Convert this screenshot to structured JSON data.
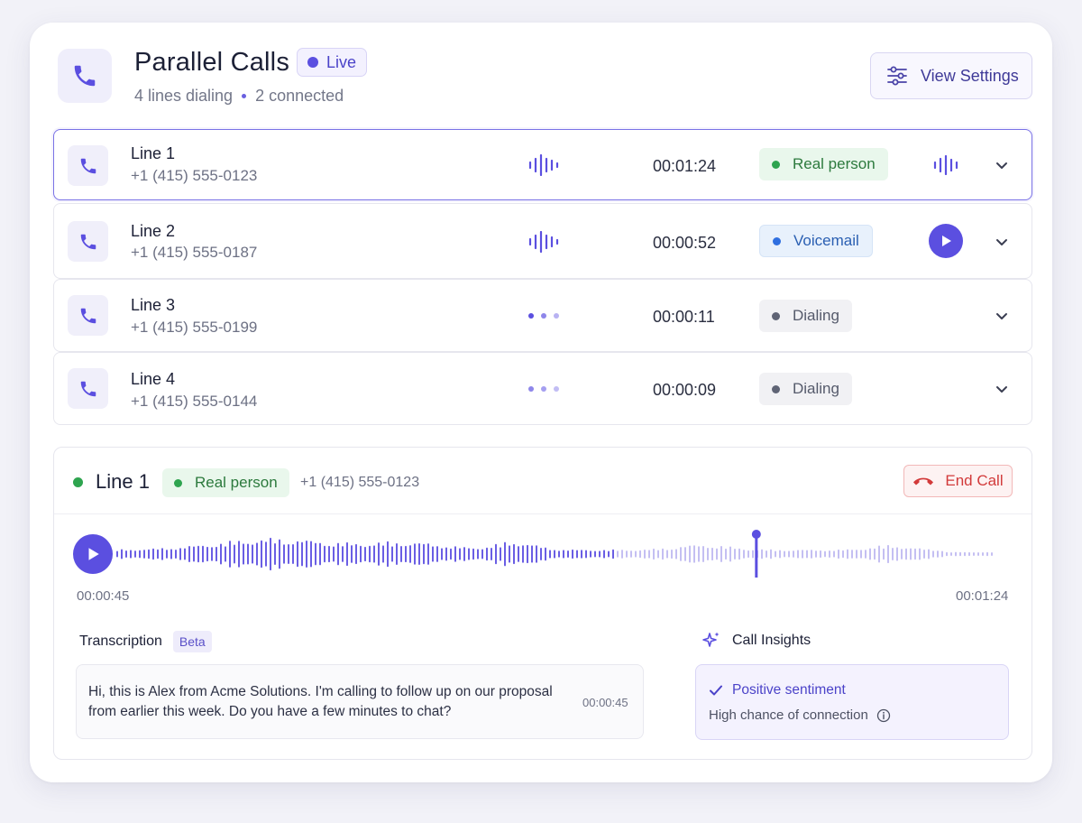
{
  "header": {
    "title": "Parallel Calls",
    "live_label": "Live",
    "lines_dialing": "4 lines dialing",
    "connected": "2 connected",
    "settings_label": "View Settings"
  },
  "lines": [
    {
      "name": "Line 1",
      "phone": "+1 (415) 555-0123",
      "time": "00:01:24",
      "status": "Real person",
      "activity": "audio-wave-icon",
      "action": "audio-wave-icon"
    },
    {
      "name": "Line 2",
      "phone": "+1 (415) 555-0187",
      "time": "00:00:52",
      "status": "Voicemail",
      "activity": "audio-wave-icon",
      "action": "play-icon"
    },
    {
      "name": "Line 3",
      "phone": "+1 (415) 555-0199",
      "time": "00:00:11",
      "status": "Dialing",
      "activity": "typing-dots-icon",
      "action": ""
    },
    {
      "name": "Line 4",
      "phone": "+1 (415) 555-0144",
      "time": "00:00:09",
      "status": "Dialing",
      "activity": "typing-dots-icon",
      "action": ""
    }
  ],
  "detail": {
    "line_name": "Line 1",
    "status": "Real person",
    "phone": "+1 (415) 555-0123",
    "end_call_label": "End Call",
    "current_time": "00:00:45",
    "total_time": "00:01:24",
    "playhead_fraction": 0.73
  },
  "transcription": {
    "title": "Transcription",
    "badge": "Beta",
    "text": "Hi, this is Alex from Acme Solutions. I'm calling to follow up on our proposal from earlier this week. Do you have a few minutes to chat?",
    "timestamp": "00:00:45"
  },
  "insights": {
    "title": "Call Insights",
    "sentiment": "Positive sentiment",
    "detail": "High chance of connection"
  },
  "colors": {
    "accent": "#5b4fe0",
    "real_person": "#2ea44f",
    "voicemail": "#2f6fe0",
    "dialing": "#5f6475",
    "end_call": "#d23a3a"
  }
}
